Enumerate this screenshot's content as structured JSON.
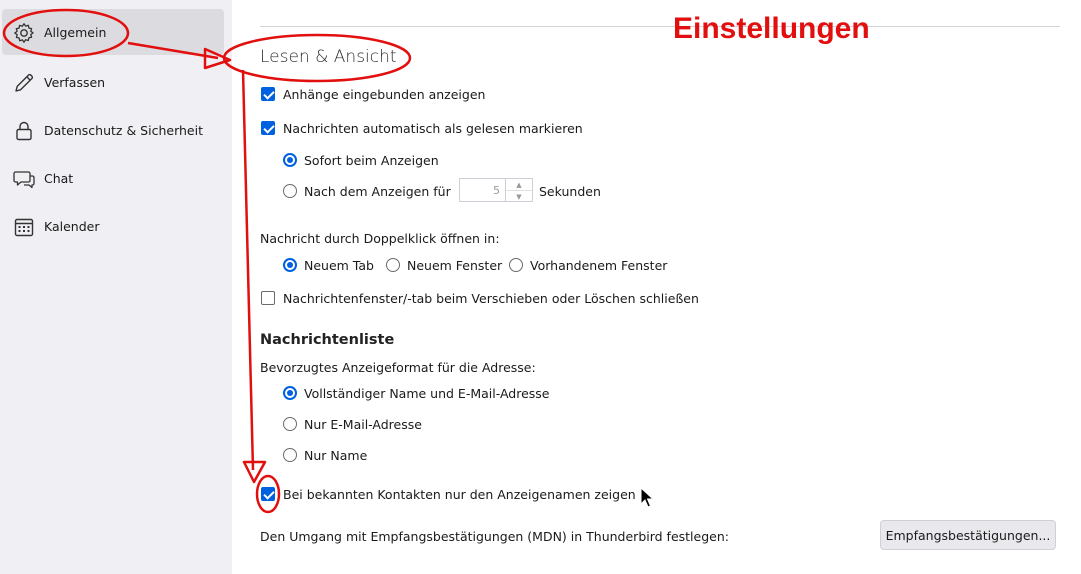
{
  "sidebar": {
    "items": [
      {
        "label": "Allgemein",
        "icon": "gear-icon",
        "selected": true
      },
      {
        "label": "Verfassen",
        "icon": "pencil-icon",
        "selected": false
      },
      {
        "label": "Datenschutz & Sicherheit",
        "icon": "lock-icon",
        "selected": false
      },
      {
        "label": "Chat",
        "icon": "chat-icon",
        "selected": false
      },
      {
        "label": "Kalender",
        "icon": "calendar-icon",
        "selected": false
      }
    ]
  },
  "annotation": {
    "title": "Einstellungen",
    "color": "#e20f0f"
  },
  "reading": {
    "title": "Lesen & Ansicht",
    "show_attachments_inline": {
      "label": "Anhänge eingebunden anzeigen",
      "checked": true
    },
    "auto_mark_read": {
      "label": "Nachrichten automatisch als gelesen markieren",
      "checked": true
    },
    "mark_immediately": {
      "label": "Sofort beim Anzeigen",
      "checked": true
    },
    "mark_after": {
      "label": "Nach dem Anzeigen für",
      "checked": false
    },
    "delay_seconds": "5",
    "seconds_label": "Sekunden",
    "double_click_label": "Nachricht durch Doppelklick öffnen in:",
    "open_new_tab": {
      "label": "Neuem Tab",
      "checked": true
    },
    "open_new_window": {
      "label": "Neuem Fenster",
      "checked": false
    },
    "open_existing_window": {
      "label": "Vorhandenem Fenster",
      "checked": false
    },
    "close_on_move": {
      "label": "Nachrichtenfenster/-tab beim Verschieben oder Löschen schließen",
      "checked": false
    }
  },
  "message_list": {
    "title": "Nachrichtenliste",
    "address_format_label": "Bevorzugtes Anzeigeformat für die Adresse:",
    "full_name_email": {
      "label": "Vollständiger Name und E-Mail-Adresse",
      "checked": true
    },
    "email_only": {
      "label": "Nur E-Mail-Adresse",
      "checked": false
    },
    "name_only": {
      "label": "Nur Name",
      "checked": false
    },
    "known_contacts_display_name": {
      "label": "Bei bekannten Kontakten nur den Anzeigenamen zeigen",
      "checked": true
    }
  },
  "mdn": {
    "label": "Den Umgang mit Empfangsbestätigungen (MDN) in Thunderbird festlegen:",
    "button": "Empfangsbestätigungen..."
  }
}
